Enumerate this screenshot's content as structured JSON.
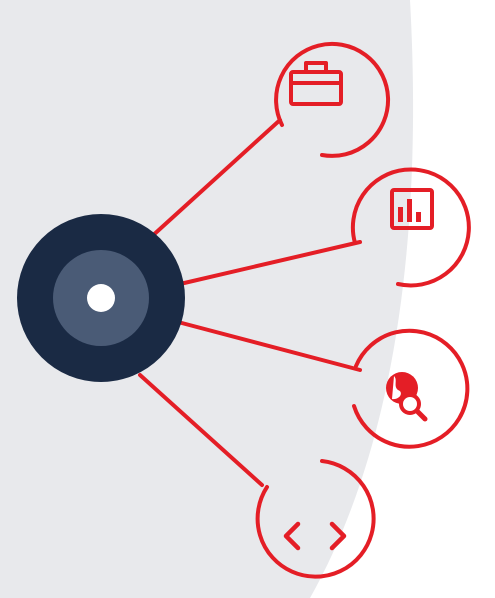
{
  "colors": {
    "panel": "#e8e9ec",
    "accent": "#e41e26",
    "hub_outer": "#1a2a44",
    "hub_mid": "#4a5b76",
    "hub_dot": "#ffffff",
    "background": "#ffffff"
  },
  "hub": {
    "icon": "hub-node"
  },
  "nodes": [
    {
      "id": "briefcase",
      "icon": "briefcase-icon"
    },
    {
      "id": "chart",
      "icon": "bar-chart-icon"
    },
    {
      "id": "search",
      "icon": "globe-search-icon"
    },
    {
      "id": "code",
      "icon": "code-brackets-icon"
    }
  ]
}
